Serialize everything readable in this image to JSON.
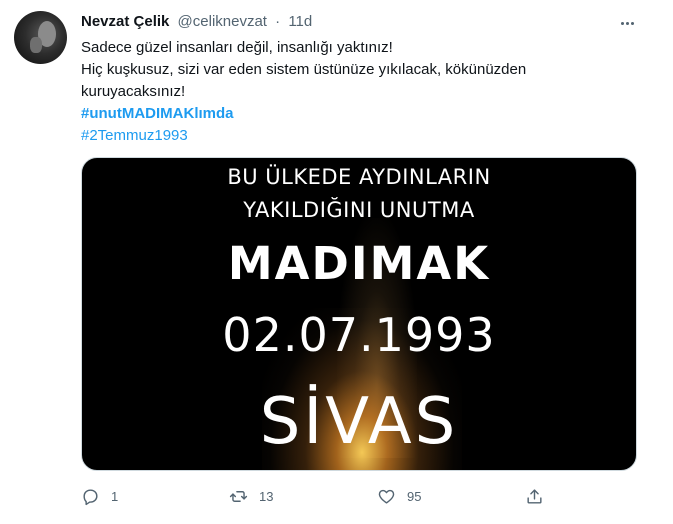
{
  "tweet": {
    "author_name": "Nevzat Çelik",
    "handle": "@celiknevzat",
    "separator": "·",
    "time": "11d",
    "text_lines": [
      "Sadece güzel insanları değil, insanlığı yaktınız!",
      "Hiç kuşkusuz, sizi var eden sistem üstünüze yıkılacak, kökünüzden",
      "kuruyacaksınız!"
    ],
    "hashtags": [
      "#unutMADIMAKlımda",
      "#2Temmuz1993"
    ],
    "media_text": {
      "line1": "BU ÜLKEDE AYDINLARIN",
      "line2": "YAKILDIĞINI UNUTMA",
      "line3": "MADIMAK",
      "line4": "02.07.1993",
      "line5": "SİVAS"
    },
    "actions": {
      "reply_count": "1",
      "retweet_count": "13",
      "like_count": "95"
    }
  },
  "icons": {
    "more": "more-horizontal-icon",
    "reply": "reply-icon",
    "retweet": "retweet-icon",
    "like": "heart-icon",
    "share": "share-icon"
  },
  "colors": {
    "link": "#1d9bf0",
    "secondary_text": "#536471",
    "primary_text": "#0f1419"
  }
}
